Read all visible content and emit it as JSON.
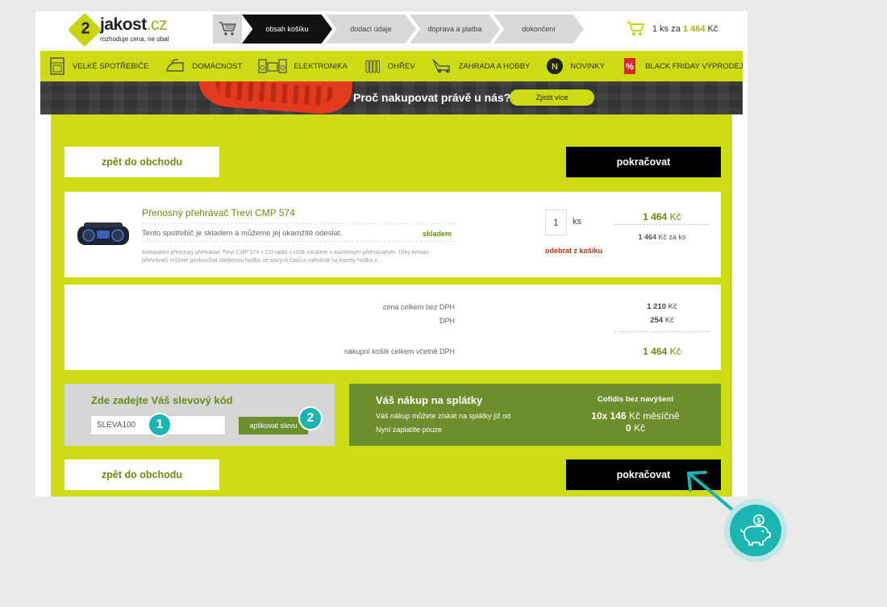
{
  "header": {
    "logo": {
      "mark": "2",
      "name": "jakost",
      "tld": ".cz",
      "tagline": "rozhoduje cena, ne obal"
    },
    "steps": [
      "obsah košíku",
      "dodací údaje",
      "doprava a platba",
      "dokončení"
    ],
    "mini_cart": {
      "qty_text": "1 ks za",
      "price_number": "1 464",
      "price_currency": "Kč"
    }
  },
  "nav": {
    "items": [
      {
        "label": "VELKÉ SPOTŘEBIČE",
        "icon": "fridge-icon"
      },
      {
        "label": "DOMÁCNOST",
        "icon": "iron-icon"
      },
      {
        "label": "ELEKTRONIKA",
        "icon": "stereo-icon"
      },
      {
        "label": "OHŘEV",
        "icon": "radiator-icon"
      },
      {
        "label": "ZAHRADA A HOBBY",
        "icon": "lawnmower-icon"
      },
      {
        "label": "NOVINKY",
        "icon": "new-badge-icon",
        "glyph": "N"
      },
      {
        "label": "BLACK FRIDAY VÝPRODEJ",
        "icon": "percent-tag-icon",
        "glyph": "%"
      }
    ]
  },
  "banner": {
    "text": "Proč nakupovat právě u nás?",
    "button": "Zjistit více"
  },
  "actions": {
    "back": "zpět do obchodu",
    "continue": "pokračovat"
  },
  "product": {
    "name": "Přenosný přehrávač Trevi CMP 574",
    "stock_text": "Tento spotřebič je skladem a můžeme jej okamžitě odeslat.",
    "stock_badge": "skladem",
    "description": "Kompaktní přenosný přehrávač Trevi CMP 574 s CD rádio s USB vstupem a kazetovým přehrávačem. Díky tomuto přehrávači můžete poslouchat oblíbenou hudbu ze starých časů a nahrávat na kazety hudbu z...",
    "qty": "1",
    "qty_unit": "ks",
    "remove": "odebrat z košíku",
    "price_number": "1 464",
    "price_currency": "Kč",
    "unit_price_number": "1 464",
    "unit_price_suffix": "Kč za ks"
  },
  "totals": {
    "without_vat_label": "cena celkem bez DPH",
    "without_vat_number": "1 210",
    "vat_label": "DPH",
    "vat_number": "254",
    "total_label": "nákupní košík celkem včetně DPH",
    "total_number": "1 464",
    "currency": "Kč"
  },
  "discount": {
    "title": "Zde zadejte Váš slevový kód",
    "input_value": "SLEVA100",
    "button": "aplikovat slevu"
  },
  "installments": {
    "title": "Váš nákup na splátky",
    "line1": "Váš nákup můžete získat na splátky již od",
    "line2": "Nyní zaplatíte pouze",
    "provider": "Cofidis bez navýšení",
    "monthly_number": "10x 146",
    "monthly_suffix": "Kč měsíčně",
    "upfront_number": "0",
    "upfront_currency": "Kč"
  },
  "markers": [
    "1",
    "2"
  ],
  "colors": {
    "lime": "#cddb13",
    "green": "#6a8f2c",
    "dark_green_text": "#6a8a10",
    "teal": "#1ab5b0",
    "black": "#000000"
  },
  "overlay_icon": "piggy-bank-icon"
}
